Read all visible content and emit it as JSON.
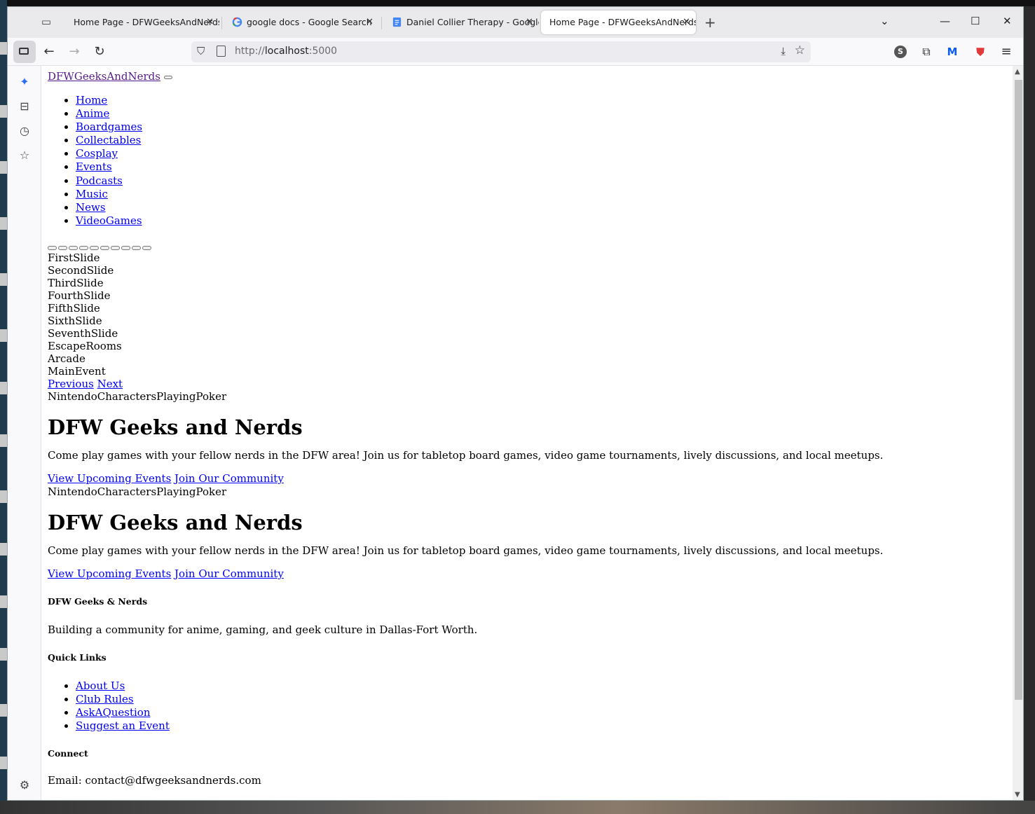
{
  "browser": {
    "tabs": [
      {
        "title": "Home Page - DFWGeeksAndNerds",
        "active": false,
        "favicon": "none"
      },
      {
        "title": "google docs - Google Search",
        "active": false,
        "favicon": "google-g-icon"
      },
      {
        "title": "Daniel Collier Therapy - Google",
        "active": false,
        "favicon": "google-docs-icon"
      },
      {
        "title": "Home Page - DFWGeeksAndNerds",
        "active": true,
        "favicon": "none"
      }
    ],
    "url_prefix": "http://",
    "url_host": "localhost",
    "url_port": ":5000",
    "extension_avatar_letter": "S",
    "extension_m_letter": "M"
  },
  "page": {
    "brand": "DFWGeeksAndNerds",
    "nav": [
      "Home",
      "Anime",
      "Boardgames",
      "Collectables",
      "Cosplay",
      "Events",
      "Podcasts",
      "Music",
      "News",
      "VideoGames"
    ],
    "slides": [
      "FirstSlide",
      "SecondSlide",
      "ThirdSlide",
      "FourthSlide",
      "FifthSlide",
      "SixthSlide",
      "SeventhSlide",
      "EscapeRooms",
      "Arcade",
      "MainEvent"
    ],
    "carousel_prev": "Previous",
    "carousel_next": "Next",
    "hero_blocks": [
      {
        "image_alt": "NintendoCharactersPlayingPoker",
        "title": "DFW Geeks and Nerds",
        "text": "Come play games with your fellow nerds in the DFW area! Join us for tabletop board games, video game tournaments, lively discussions, and local meetups.",
        "btn_events": "View Upcoming Events",
        "btn_community": "Join Our Community"
      },
      {
        "image_alt": "NintendoCharactersPlayingPoker",
        "title": "DFW Geeks and Nerds",
        "text": "Come play games with your fellow nerds in the DFW area! Join us for tabletop board games, video game tournaments, lively discussions, and local meetups.",
        "btn_events": "View Upcoming Events",
        "btn_community": "Join Our Community"
      }
    ],
    "footer": {
      "about_heading": "DFW Geeks & Nerds",
      "about_text": "Building a community for anime, gaming, and geek culture in Dallas-Fort Worth.",
      "links_heading": "Quick Links",
      "links": [
        "About Us",
        "Club Rules",
        "AskAQuestion",
        "Suggest an Event"
      ],
      "connect_heading": "Connect",
      "connect_partial": "Email: contact@dfwgeeksandnerds.com"
    }
  }
}
